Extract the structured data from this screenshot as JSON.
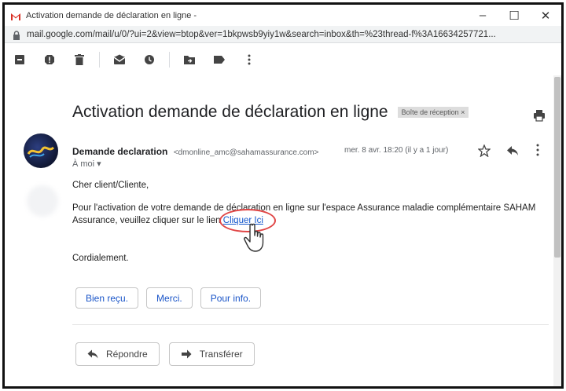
{
  "window": {
    "tab_title": "Activation demande de déclaration en ligne -",
    "controls": {
      "minimize": "–",
      "maximize": "☐",
      "close": "✕"
    }
  },
  "address_bar": {
    "url": "mail.google.com/mail/u/0/?ui=2&view=btop&ver=1bkpwsb9yiy1w&search=inbox&th=%23thread-f%3A16634257721..."
  },
  "toolbar": {
    "icons": [
      "archive-icon",
      "report-spam-icon",
      "delete-icon",
      "mark-unread-icon",
      "snooze-icon",
      "move-to-icon",
      "label-icon",
      "more-vertical-icon"
    ]
  },
  "message": {
    "subject": "Activation demande de déclaration en ligne",
    "label": "Boîte de réception ×",
    "sender_name": "Demande declaration",
    "sender_email": "<dmonline_amc@sahamassurance.com>",
    "date": "mer. 8 avr. 18:20 (il y a 1 jour)",
    "to": "À moi ▾",
    "greeting": "Cher client/Cliente,",
    "body": "Pour l'activation de votre demande de déclaration en ligne sur l'espace Assurance maladie complémentaire SAHAM Assurance, veuillez cliquer sur le lien ",
    "link_text": "Cliquer Ici",
    "signoff": "Cordialement."
  },
  "smart_replies": [
    "Bien reçu.",
    "Merci.",
    "Pour info."
  ],
  "actions": {
    "reply": "Répondre",
    "forward": "Transférer"
  },
  "colors": {
    "link": "#1155cc",
    "highlight": "#e04545",
    "gmail_red": "#d93025"
  }
}
